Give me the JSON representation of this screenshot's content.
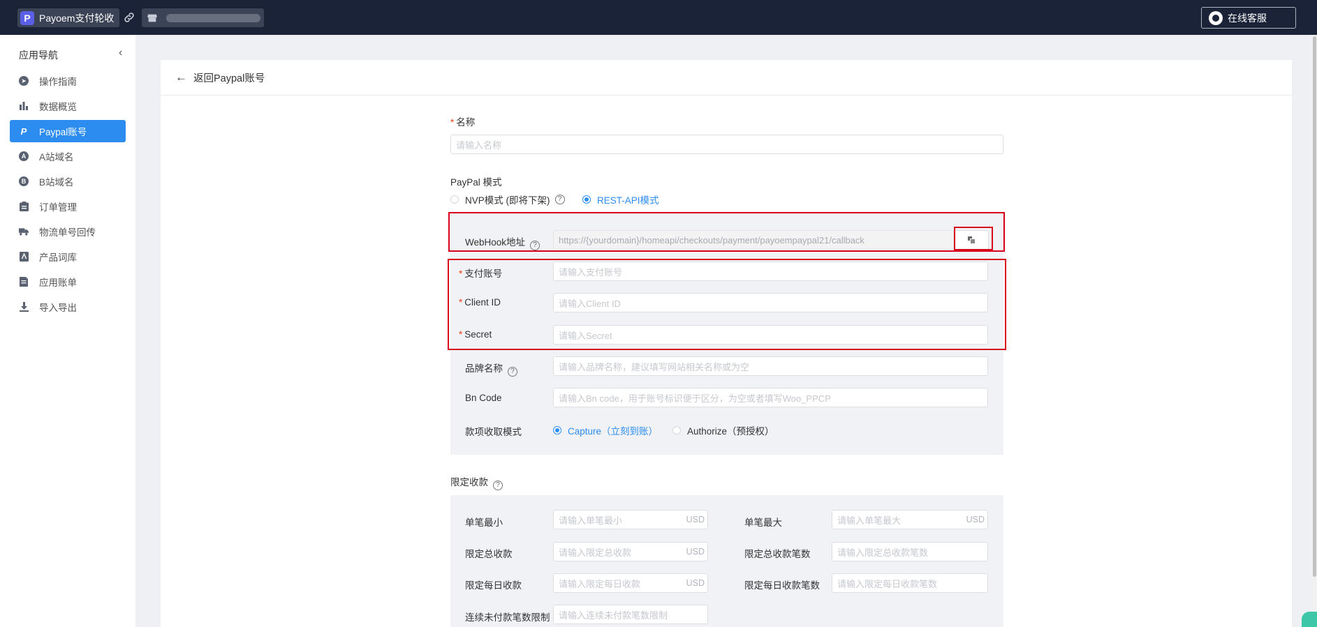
{
  "header": {
    "app_name": "Payoem支付轮收",
    "service_label": "在线客服"
  },
  "sidebar": {
    "title": "应用导航",
    "collapse_icon": "chevron-left-icon",
    "items": [
      {
        "label": "操作指南",
        "icon": "compass-icon"
      },
      {
        "label": "数据概览",
        "icon": "bar-chart-icon"
      },
      {
        "label": "Paypal账号",
        "icon": "paypal-icon",
        "active": true
      },
      {
        "label": "A站域名",
        "icon": "letter-a-icon"
      },
      {
        "label": "B站域名",
        "icon": "letter-b-icon"
      },
      {
        "label": "订单管理",
        "icon": "clipboard-icon"
      },
      {
        "label": "物流单号回传",
        "icon": "truck-icon"
      },
      {
        "label": "产品词库",
        "icon": "book-icon"
      },
      {
        "label": "应用账单",
        "icon": "bill-icon"
      },
      {
        "label": "导入导出",
        "icon": "download-icon"
      }
    ]
  },
  "main": {
    "back_label": "返回Paypal账号",
    "name": {
      "label": "名称",
      "placeholder": "请输入名称"
    },
    "mode": {
      "label": "PayPal 模式",
      "options": [
        "NVP模式 (即将下架)",
        "REST-API模式"
      ],
      "selected": "REST-API模式"
    },
    "webhook": {
      "label": "WebHook地址",
      "value": "https://{yourdomain}/homeapi/checkouts/payment/payoempaypal21/callback"
    },
    "account": {
      "label": "支付账号",
      "placeholder": "请输入支付账号"
    },
    "client_id": {
      "label": "Client ID",
      "placeholder": "请输入Client ID"
    },
    "secret": {
      "label": "Secret",
      "placeholder": "请输入Secret"
    },
    "brand": {
      "label": "品牌名称",
      "placeholder": "请输入品牌名称，建议填写网站相关名称或为空"
    },
    "bn_code": {
      "label": "Bn Code",
      "placeholder": "请输入Bn code，用于账号标识便于区分，为空或者填写Woo_PPCP"
    },
    "capture_mode": {
      "label": "款项收取模式",
      "options": [
        "Capture（立刻到账）",
        "Authorize（预授权）"
      ],
      "selected": "Capture（立刻到账）"
    },
    "limits": {
      "title": "限定收款",
      "currency": "USD",
      "single_min": {
        "label": "单笔最小",
        "placeholder": "请输入单笔最小"
      },
      "single_max": {
        "label": "单笔最大",
        "placeholder": "请输入单笔最大"
      },
      "total_amount": {
        "label": "限定总收款",
        "placeholder": "请输入限定总收款"
      },
      "total_count": {
        "label": "限定总收款笔数",
        "placeholder": "请输入限定总收款笔数"
      },
      "daily_amount": {
        "label": "限定每日收款",
        "placeholder": "请输入限定每日收款"
      },
      "daily_count": {
        "label": "限定每日收款笔数",
        "placeholder": "请输入限定每日收款笔数"
      },
      "unpaid_limit": {
        "label": "连续未付款笔数限制",
        "placeholder": "请输入连续未付款笔数限制"
      }
    }
  },
  "colors": {
    "accent": "#2d8cf0",
    "topbar": "#1b2338",
    "highlight_box": "#d9001b",
    "required": "#ed4014"
  }
}
